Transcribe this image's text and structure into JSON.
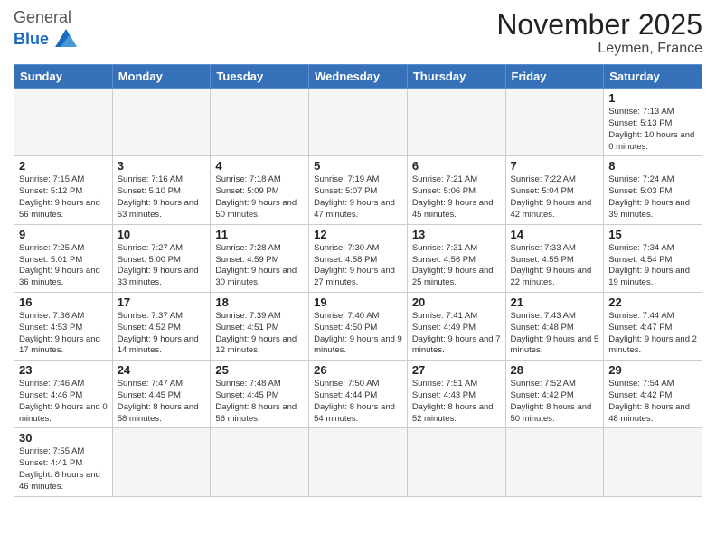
{
  "logo": {
    "general": "General",
    "blue": "Blue"
  },
  "title": "November 2025",
  "subtitle": "Leymen, France",
  "days_of_week": [
    "Sunday",
    "Monday",
    "Tuesday",
    "Wednesday",
    "Thursday",
    "Friday",
    "Saturday"
  ],
  "weeks": [
    [
      {
        "day": "",
        "info": ""
      },
      {
        "day": "",
        "info": ""
      },
      {
        "day": "",
        "info": ""
      },
      {
        "day": "",
        "info": ""
      },
      {
        "day": "",
        "info": ""
      },
      {
        "day": "",
        "info": ""
      },
      {
        "day": "1",
        "info": "Sunrise: 7:13 AM\nSunset: 5:13 PM\nDaylight: 10 hours and 0 minutes."
      }
    ],
    [
      {
        "day": "2",
        "info": "Sunrise: 7:15 AM\nSunset: 5:12 PM\nDaylight: 9 hours and 56 minutes."
      },
      {
        "day": "3",
        "info": "Sunrise: 7:16 AM\nSunset: 5:10 PM\nDaylight: 9 hours and 53 minutes."
      },
      {
        "day": "4",
        "info": "Sunrise: 7:18 AM\nSunset: 5:09 PM\nDaylight: 9 hours and 50 minutes."
      },
      {
        "day": "5",
        "info": "Sunrise: 7:19 AM\nSunset: 5:07 PM\nDaylight: 9 hours and 47 minutes."
      },
      {
        "day": "6",
        "info": "Sunrise: 7:21 AM\nSunset: 5:06 PM\nDaylight: 9 hours and 45 minutes."
      },
      {
        "day": "7",
        "info": "Sunrise: 7:22 AM\nSunset: 5:04 PM\nDaylight: 9 hours and 42 minutes."
      },
      {
        "day": "8",
        "info": "Sunrise: 7:24 AM\nSunset: 5:03 PM\nDaylight: 9 hours and 39 minutes."
      }
    ],
    [
      {
        "day": "9",
        "info": "Sunrise: 7:25 AM\nSunset: 5:01 PM\nDaylight: 9 hours and 36 minutes."
      },
      {
        "day": "10",
        "info": "Sunrise: 7:27 AM\nSunset: 5:00 PM\nDaylight: 9 hours and 33 minutes."
      },
      {
        "day": "11",
        "info": "Sunrise: 7:28 AM\nSunset: 4:59 PM\nDaylight: 9 hours and 30 minutes."
      },
      {
        "day": "12",
        "info": "Sunrise: 7:30 AM\nSunset: 4:58 PM\nDaylight: 9 hours and 27 minutes."
      },
      {
        "day": "13",
        "info": "Sunrise: 7:31 AM\nSunset: 4:56 PM\nDaylight: 9 hours and 25 minutes."
      },
      {
        "day": "14",
        "info": "Sunrise: 7:33 AM\nSunset: 4:55 PM\nDaylight: 9 hours and 22 minutes."
      },
      {
        "day": "15",
        "info": "Sunrise: 7:34 AM\nSunset: 4:54 PM\nDaylight: 9 hours and 19 minutes."
      }
    ],
    [
      {
        "day": "16",
        "info": "Sunrise: 7:36 AM\nSunset: 4:53 PM\nDaylight: 9 hours and 17 minutes."
      },
      {
        "day": "17",
        "info": "Sunrise: 7:37 AM\nSunset: 4:52 PM\nDaylight: 9 hours and 14 minutes."
      },
      {
        "day": "18",
        "info": "Sunrise: 7:39 AM\nSunset: 4:51 PM\nDaylight: 9 hours and 12 minutes."
      },
      {
        "day": "19",
        "info": "Sunrise: 7:40 AM\nSunset: 4:50 PM\nDaylight: 9 hours and 9 minutes."
      },
      {
        "day": "20",
        "info": "Sunrise: 7:41 AM\nSunset: 4:49 PM\nDaylight: 9 hours and 7 minutes."
      },
      {
        "day": "21",
        "info": "Sunrise: 7:43 AM\nSunset: 4:48 PM\nDaylight: 9 hours and 5 minutes."
      },
      {
        "day": "22",
        "info": "Sunrise: 7:44 AM\nSunset: 4:47 PM\nDaylight: 9 hours and 2 minutes."
      }
    ],
    [
      {
        "day": "23",
        "info": "Sunrise: 7:46 AM\nSunset: 4:46 PM\nDaylight: 9 hours and 0 minutes."
      },
      {
        "day": "24",
        "info": "Sunrise: 7:47 AM\nSunset: 4:45 PM\nDaylight: 8 hours and 58 minutes."
      },
      {
        "day": "25",
        "info": "Sunrise: 7:48 AM\nSunset: 4:45 PM\nDaylight: 8 hours and 56 minutes."
      },
      {
        "day": "26",
        "info": "Sunrise: 7:50 AM\nSunset: 4:44 PM\nDaylight: 8 hours and 54 minutes."
      },
      {
        "day": "27",
        "info": "Sunrise: 7:51 AM\nSunset: 4:43 PM\nDaylight: 8 hours and 52 minutes."
      },
      {
        "day": "28",
        "info": "Sunrise: 7:52 AM\nSunset: 4:42 PM\nDaylight: 8 hours and 50 minutes."
      },
      {
        "day": "29",
        "info": "Sunrise: 7:54 AM\nSunset: 4:42 PM\nDaylight: 8 hours and 48 minutes."
      }
    ],
    [
      {
        "day": "30",
        "info": "Sunrise: 7:55 AM\nSunset: 4:41 PM\nDaylight: 8 hours and 46 minutes."
      },
      {
        "day": "",
        "info": ""
      },
      {
        "day": "",
        "info": ""
      },
      {
        "day": "",
        "info": ""
      },
      {
        "day": "",
        "info": ""
      },
      {
        "day": "",
        "info": ""
      },
      {
        "day": "",
        "info": ""
      }
    ]
  ]
}
